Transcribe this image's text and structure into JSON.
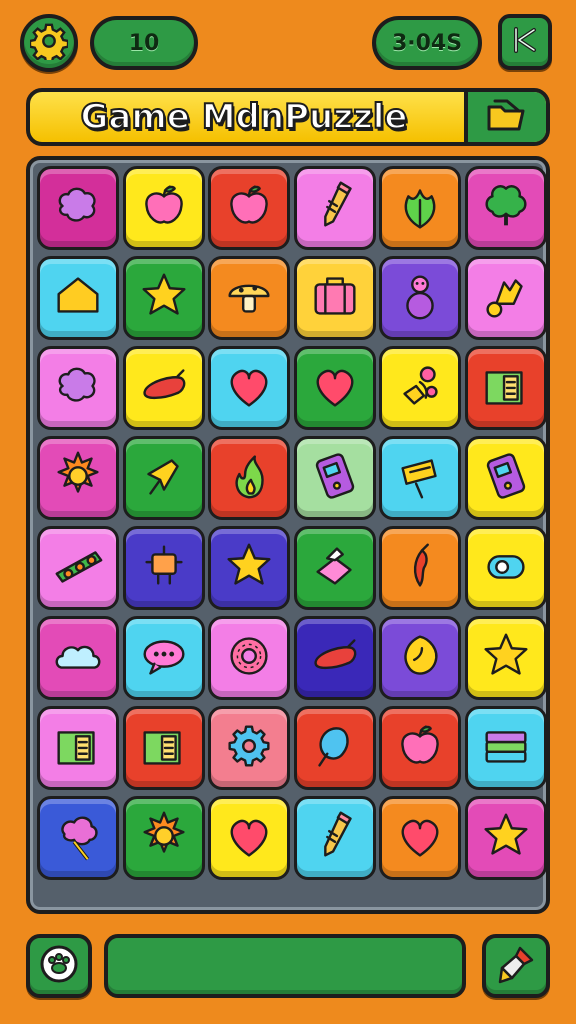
{
  "header": {
    "moves": "10",
    "timer": "3·04S",
    "settings_icon": "gear-icon",
    "close_icon": "close-icon"
  },
  "title": {
    "text": "Game MdnPuzzle",
    "action_icon": "folder-icon"
  },
  "board": {
    "rows": 8,
    "cols": 6,
    "tiles": [
      [
        {
          "color": "#d32f9a",
          "icon": "blob"
        },
        {
          "color": "#ffe81c",
          "icon": "apple"
        },
        {
          "color": "#e8412b",
          "icon": "apple"
        },
        {
          "color": "#f37ee6",
          "icon": "pencil"
        },
        {
          "color": "#f48a1f",
          "icon": "leaf"
        },
        {
          "color": "#e34bb7",
          "icon": "tree"
        }
      ],
      [
        {
          "color": "#4fd4f0",
          "icon": "house"
        },
        {
          "color": "#2ba83c",
          "icon": "star"
        },
        {
          "color": "#f48a1f",
          "icon": "mushroom"
        },
        {
          "color": "#ffd23a",
          "icon": "suitcase"
        },
        {
          "color": "#7b4bd8",
          "icon": "snowman"
        },
        {
          "color": "#f37ee6",
          "icon": "crown"
        }
      ],
      [
        {
          "color": "#f37ee6",
          "icon": "blob"
        },
        {
          "color": "#ffe81c",
          "icon": "sausage"
        },
        {
          "color": "#4fd4f0",
          "icon": "heart"
        },
        {
          "color": "#2ba83c",
          "icon": "heart"
        },
        {
          "color": "#ffe81c",
          "icon": "flowers"
        },
        {
          "color": "#e8412b",
          "icon": "book"
        }
      ],
      [
        {
          "color": "#e34bb7",
          "icon": "sun"
        },
        {
          "color": "#2ba83c",
          "icon": "pin"
        },
        {
          "color": "#e8412b",
          "icon": "flame"
        },
        {
          "color": "#a5dfa0",
          "icon": "phone"
        },
        {
          "color": "#4fd4f0",
          "icon": "sign"
        },
        {
          "color": "#ffe81c",
          "icon": "phone"
        }
      ],
      [
        {
          "color": "#f37ee6",
          "icon": "skateboard"
        },
        {
          "color": "#4a3bc8",
          "icon": "robot"
        },
        {
          "color": "#4a3bc8",
          "icon": "star"
        },
        {
          "color": "#2ba83c",
          "icon": "bottle"
        },
        {
          "color": "#f48a1f",
          "icon": "pepper"
        },
        {
          "color": "#ffe81c",
          "icon": "tape"
        }
      ],
      [
        {
          "color": "#e34bb7",
          "icon": "cloud"
        },
        {
          "color": "#4fd4f0",
          "icon": "bubble"
        },
        {
          "color": "#f37ee6",
          "icon": "donut"
        },
        {
          "color": "#3a28b8",
          "icon": "sausage"
        },
        {
          "color": "#7b4bd8",
          "icon": "lemon"
        },
        {
          "color": "#ffe81c",
          "icon": "star"
        }
      ],
      [
        {
          "color": "#f37ee6",
          "icon": "book"
        },
        {
          "color": "#e8412b",
          "icon": "book"
        },
        {
          "color": "#f37e8f",
          "icon": "gear"
        },
        {
          "color": "#e8412b",
          "icon": "balloon"
        },
        {
          "color": "#e8412b",
          "icon": "apple"
        },
        {
          "color": "#4fd4f0",
          "icon": "stack"
        }
      ],
      [
        {
          "color": "#3a5ad8",
          "icon": "cotton"
        },
        {
          "color": "#2ba83c",
          "icon": "sun"
        },
        {
          "color": "#ffe81c",
          "icon": "heart"
        },
        {
          "color": "#4fd4f0",
          "icon": "pencil"
        },
        {
          "color": "#f48a1f",
          "icon": "heart"
        },
        {
          "color": "#e34bb7",
          "icon": "star"
        }
      ]
    ]
  },
  "footer": {
    "left_icon": "paw-icon",
    "right_icon": "paint-brush-icon",
    "progress_value": 0
  }
}
